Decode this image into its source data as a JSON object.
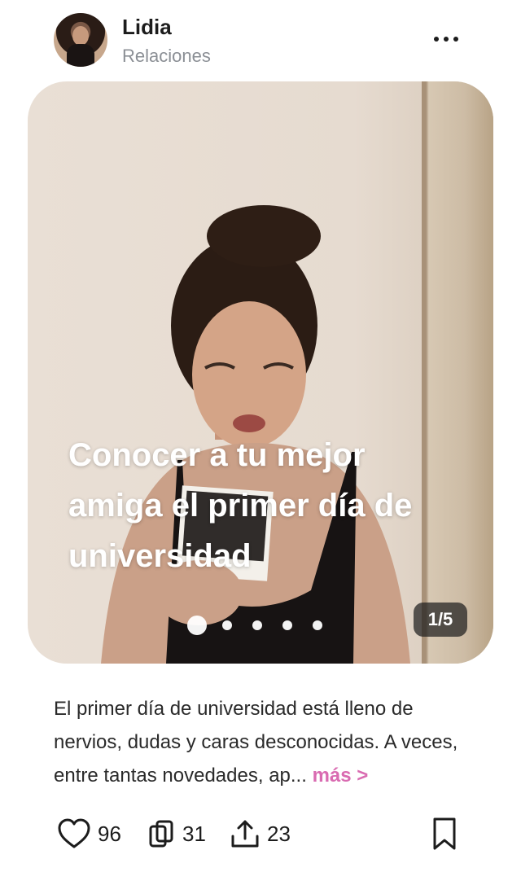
{
  "header": {
    "name": "Lidia",
    "category": "Relaciones"
  },
  "post": {
    "caption": "Conocer a tu mejor amiga el primer día de universidad",
    "counter": "1/5",
    "dots_total": 5,
    "dots_active_index": 0
  },
  "description": {
    "text": "El primer día de universidad está lleno de nervios, dudas y caras desconocidas. A veces, entre tantas novedades, ap...",
    "more_label": "más >"
  },
  "actions": {
    "likes": "96",
    "reposts": "31",
    "shares": "23"
  },
  "colors": {
    "accent": "#d96bb1",
    "text": "#1c1c1c",
    "muted": "#8b8f95"
  },
  "icons": [
    "more-dots-icon",
    "heart-icon",
    "repost-icon",
    "share-icon",
    "bookmark-icon"
  ]
}
